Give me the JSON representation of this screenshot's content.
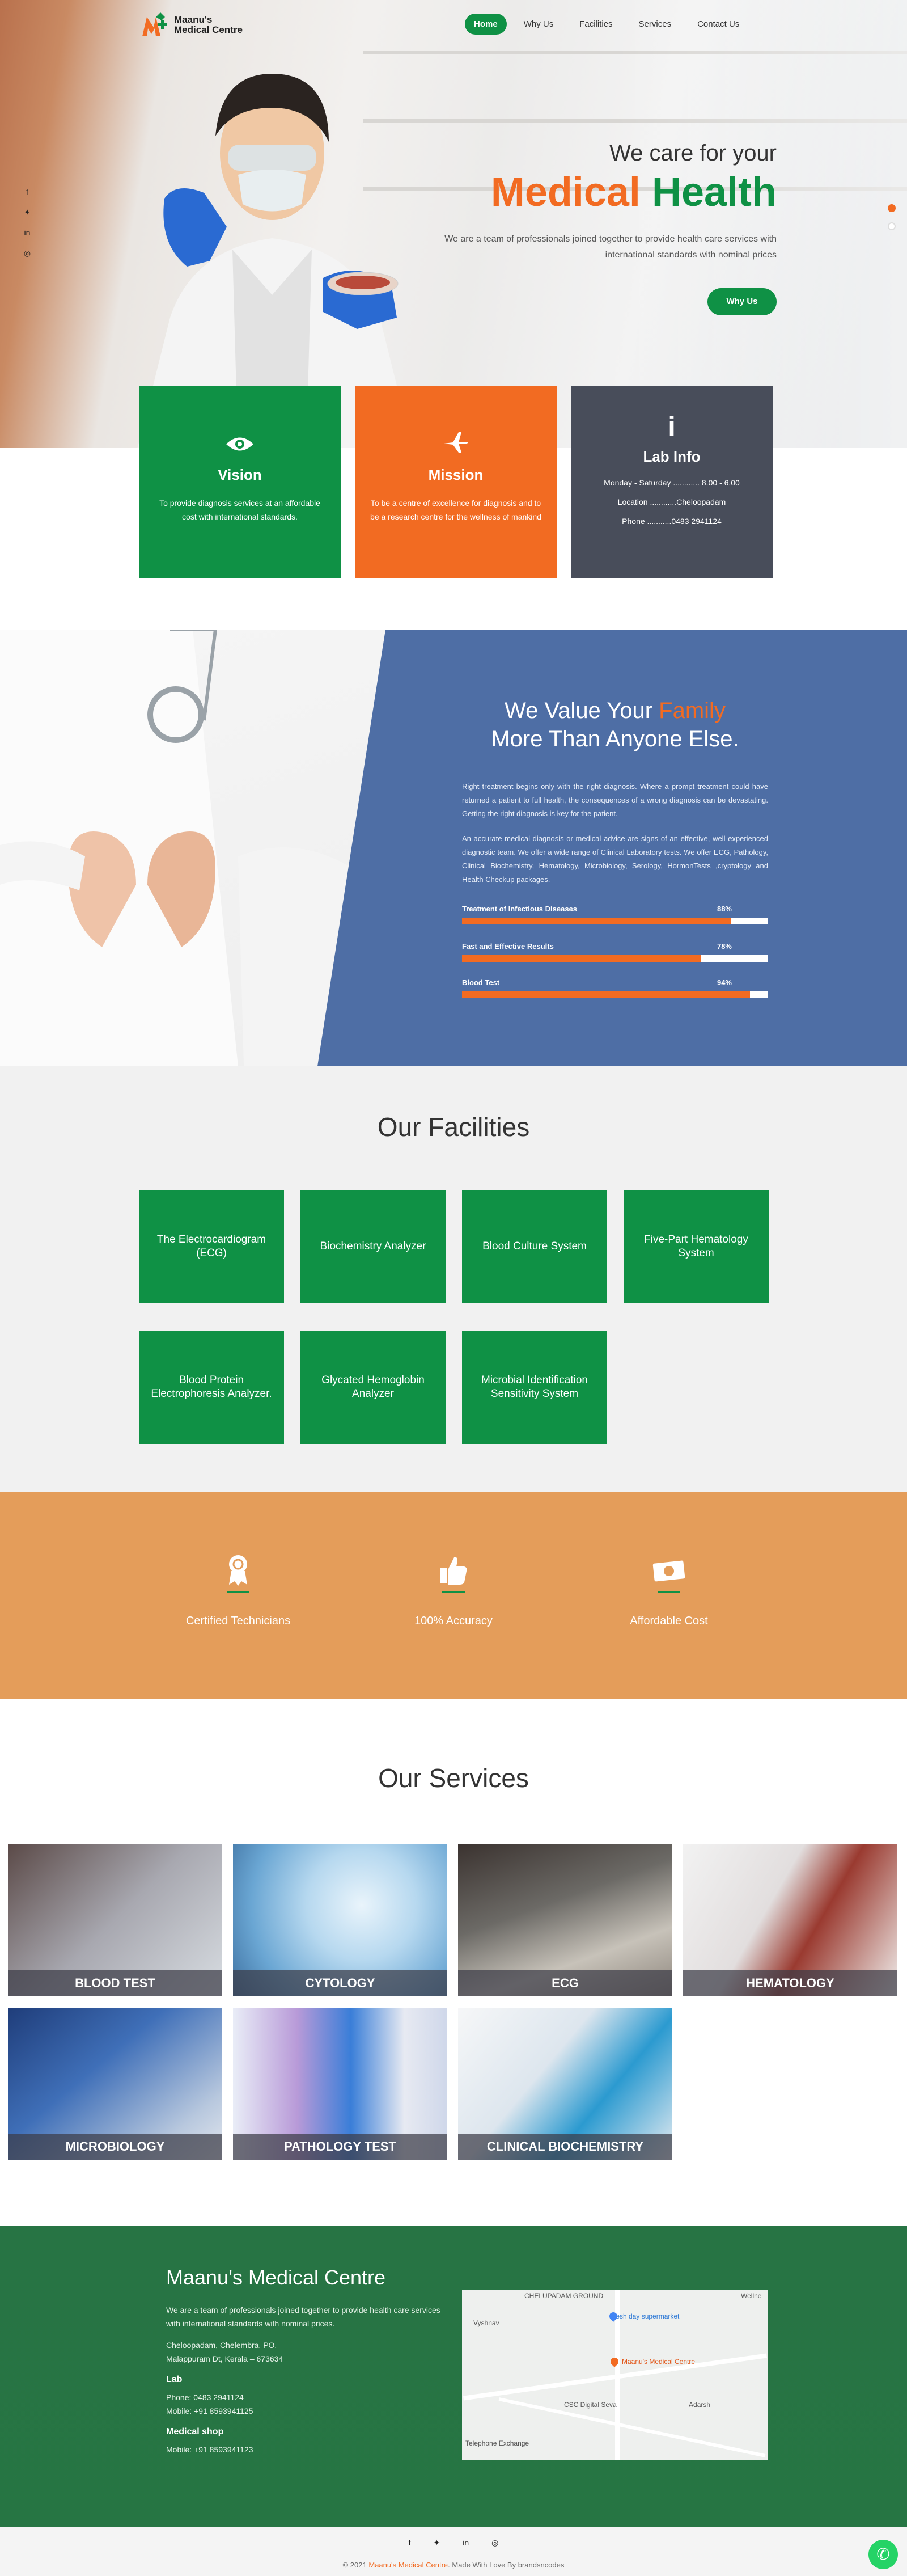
{
  "brand": {
    "name_line1": "Maanu's",
    "name_line2": "Medical Centre"
  },
  "nav": [
    "Home",
    "Why Us",
    "Facilities",
    "Services",
    "Contact Us"
  ],
  "social_icons": [
    "facebook-icon",
    "twitter-icon",
    "linkedin-icon",
    "instagram-icon"
  ],
  "hero": {
    "heading": "We care for your",
    "big_orange": "Medical",
    "big_green": "Health",
    "description": "We are a team of professionals joined together to provide health care services with international standards with nominal prices",
    "button": "Why Us"
  },
  "info": {
    "vision": {
      "title": "Vision",
      "text": "To provide diagnosis services at an affordable cost with international standards."
    },
    "mission": {
      "title": "Mission",
      "text": "To be a centre of excellence for diagnosis and to be a research centre for the wellness of mankind"
    },
    "lab": {
      "title": "Lab Info",
      "rows": [
        "Monday - Saturday ............ 8.00 - 6.00",
        "Location ............Cheloopadam",
        "Phone ...........0483 2941124"
      ]
    }
  },
  "value": {
    "title_a": "We Value Your ",
    "title_b": "Family",
    "title_c": "More Than Anyone Else.",
    "p1": "Right treatment begins only with the right diagnosis. Where a prompt treatment could have returned a patient to full health, the consequences of a wrong diagnosis can be devastating. Getting the right diagnosis is key for the patient.",
    "p2": "An accurate medical diagnosis or medical advice are signs of an effective, well experienced diagnostic team. We offer a wide range of Clinical Laboratory tests. We offer ECG, Pathology, Clinical Biochemistry, Hematology, Microbiology, Serology, HormonTests ,cryptology and Health Checkup packages.",
    "skills": [
      {
        "label": "Treatment of Infectious Diseases",
        "pct": "88%",
        "value": 88
      },
      {
        "label": "Fast and Effective Results",
        "pct": "78%",
        "value": 78
      },
      {
        "label": "Blood Test",
        "pct": "94%",
        "value": 94
      }
    ]
  },
  "facilities": {
    "title_a": "Our",
    "title_b": "Facilities",
    "items": [
      "The Electrocardiogram (ECG)",
      "Biochemistry Analyzer",
      "Blood Culture System",
      "Five-Part Hematology System",
      "Blood Protein Electrophoresis Analyzer.",
      "Glycated Hemoglobin Analyzer",
      "Microbial Identification Sensitivity System"
    ]
  },
  "stats": [
    {
      "icon": "award-icon",
      "label": "Certified Technicians"
    },
    {
      "icon": "thumbs-up-icon",
      "label": "100% Accuracy"
    },
    {
      "icon": "money-icon",
      "label": "Affordable Cost"
    }
  ],
  "services": {
    "title_a": "Our",
    "title_b": "Services",
    "items": [
      "BLOOD TEST",
      "CYTOLOGY",
      "ECG",
      "HEMATOLOGY",
      "MICROBIOLOGY",
      "PATHOLOGY TEST",
      "CLINICAL BIOCHEMISTRY"
    ]
  },
  "footer": {
    "title": "Maanu's Medical Centre",
    "about": "We are a team of professionals joined together to provide health care services with international standards with nominal prices.",
    "addr1": "Cheloopadam, Chelembra. PO,",
    "addr2": "Malappuram Dt, Kerala – 673634",
    "lab_heading": "Lab",
    "lab_phone": "Phone: 0483 2941124",
    "lab_mobile": "Mobile: +91 8593941125",
    "shop_heading": "Medical shop",
    "shop_mobile": "Mobile: +91 8593941123",
    "map_labels": [
      "CHELUPADAM GROUND",
      "Fresh day supermarket",
      "Maanu's Medical Centre",
      "CSC Digital Seva",
      "Adarsh",
      "Telephone Exchange",
      "Vyshnav",
      "Wellne"
    ]
  },
  "copyright": {
    "a": "© 2021",
    "b": "Maanu's Medical Centre",
    "c": ". Made With Love By brandsncodes"
  },
  "colors": {
    "green": "#0f9145",
    "orange": "#f26b22",
    "blue": "#4e6ea5",
    "gray": "#484d5a",
    "tan": "#e49d5a"
  }
}
